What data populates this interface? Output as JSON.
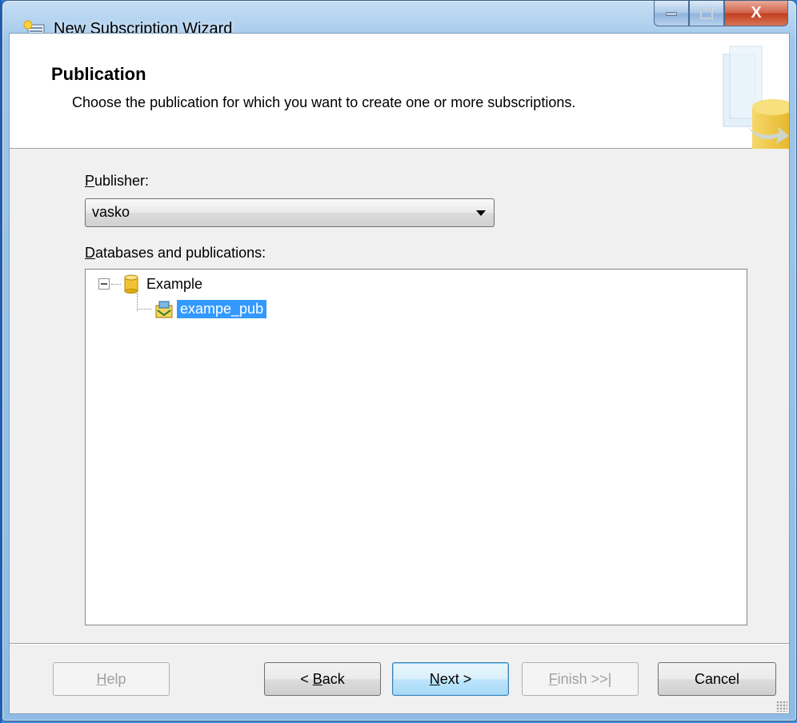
{
  "window": {
    "title": "New Subscription Wizard",
    "close_glyph": "X"
  },
  "header": {
    "title": "Publication",
    "subtitle": "Choose the publication for which you want to create one or more subscriptions."
  },
  "publisher": {
    "label_access_key": "P",
    "label_rest": "ublisher:",
    "value": "vasko"
  },
  "tree": {
    "label_access_key": "D",
    "label_rest": "atabases and publications:",
    "database": "Example",
    "publication": "exampe_pub"
  },
  "buttons": {
    "help_key": "H",
    "help_rest": "elp",
    "back_prefix": "< ",
    "back_key": "B",
    "back_rest": "ack",
    "next_key": "N",
    "next_rest": "ext >",
    "finish_key": "F",
    "finish_rest": "inish >>|",
    "cancel": "Cancel"
  },
  "colors": {
    "selection": "#3399ff",
    "desktop": "#4c9ae8"
  }
}
